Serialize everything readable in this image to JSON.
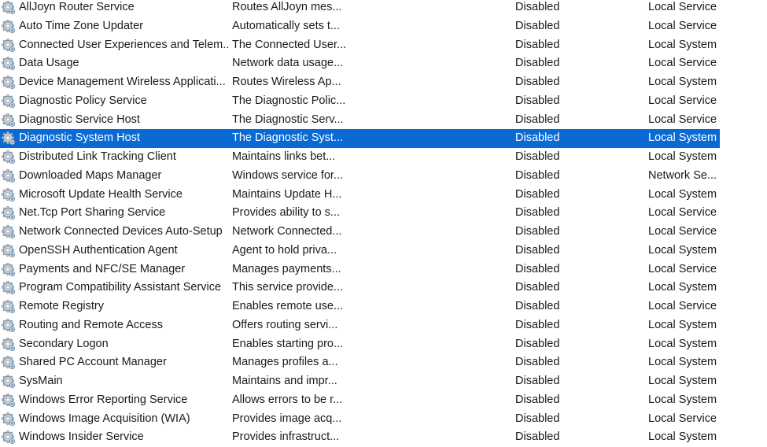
{
  "services": [
    {
      "name": "AllJoyn Router Service",
      "description": "Routes AllJoyn mes...",
      "status": "",
      "startup_type": "Disabled",
      "log_on_as": "Local Service",
      "icon": "gear-icon"
    },
    {
      "name": "Auto Time Zone Updater",
      "description": "Automatically sets t...",
      "status": "",
      "startup_type": "Disabled",
      "log_on_as": "Local Service",
      "icon": "gear-icon"
    },
    {
      "name": "Connected User Experiences and Telem...",
      "description": "The Connected User...",
      "status": "",
      "startup_type": "Disabled",
      "log_on_as": "Local System",
      "icon": "gear-icon"
    },
    {
      "name": "Data Usage",
      "description": "Network data usage...",
      "status": "",
      "startup_type": "Disabled",
      "log_on_as": "Local Service",
      "icon": "gear-icon"
    },
    {
      "name": "Device Management Wireless Applicati...",
      "description": "Routes Wireless Ap...",
      "status": "",
      "startup_type": "Disabled",
      "log_on_as": "Local System",
      "icon": "gear-icon"
    },
    {
      "name": "Diagnostic Policy Service",
      "description": "The Diagnostic Polic...",
      "status": "",
      "startup_type": "Disabled",
      "log_on_as": "Local Service",
      "icon": "gear-icon"
    },
    {
      "name": "Diagnostic Service Host",
      "description": "The Diagnostic Serv...",
      "status": "",
      "startup_type": "Disabled",
      "log_on_as": "Local Service",
      "icon": "gear-icon"
    },
    {
      "name": "Diagnostic System Host",
      "description": "The Diagnostic Syst...",
      "status": "",
      "startup_type": "Disabled",
      "log_on_as": "Local System",
      "icon": "gear-icon",
      "selected": true
    },
    {
      "name": "Distributed Link Tracking Client",
      "description": "Maintains links bet...",
      "status": "",
      "startup_type": "Disabled",
      "log_on_as": "Local System",
      "icon": "gear-icon"
    },
    {
      "name": "Downloaded Maps Manager",
      "description": "Windows service for...",
      "status": "",
      "startup_type": "Disabled",
      "log_on_as": "Network Se...",
      "icon": "gear-icon"
    },
    {
      "name": "Microsoft Update Health Service",
      "description": "Maintains Update H...",
      "status": "",
      "startup_type": "Disabled",
      "log_on_as": "Local System",
      "icon": "gear-icon"
    },
    {
      "name": "Net.Tcp Port Sharing Service",
      "description": "Provides ability to s...",
      "status": "",
      "startup_type": "Disabled",
      "log_on_as": "Local Service",
      "icon": "gear-icon"
    },
    {
      "name": "Network Connected Devices Auto-Setup",
      "description": "Network Connected...",
      "status": "",
      "startup_type": "Disabled",
      "log_on_as": "Local Service",
      "icon": "gear-icon"
    },
    {
      "name": "OpenSSH Authentication Agent",
      "description": "Agent to hold priva...",
      "status": "",
      "startup_type": "Disabled",
      "log_on_as": "Local System",
      "icon": "gear-icon"
    },
    {
      "name": "Payments and NFC/SE Manager",
      "description": "Manages payments...",
      "status": "",
      "startup_type": "Disabled",
      "log_on_as": "Local Service",
      "icon": "gear-icon"
    },
    {
      "name": "Program Compatibility Assistant Service",
      "description": "This service provide...",
      "status": "",
      "startup_type": "Disabled",
      "log_on_as": "Local System",
      "icon": "gear-icon"
    },
    {
      "name": "Remote Registry",
      "description": "Enables remote use...",
      "status": "",
      "startup_type": "Disabled",
      "log_on_as": "Local Service",
      "icon": "gear-icon"
    },
    {
      "name": "Routing and Remote Access",
      "description": "Offers routing servi...",
      "status": "",
      "startup_type": "Disabled",
      "log_on_as": "Local System",
      "icon": "gear-icon"
    },
    {
      "name": "Secondary Logon",
      "description": "Enables starting pro...",
      "status": "",
      "startup_type": "Disabled",
      "log_on_as": "Local System",
      "icon": "gear-icon"
    },
    {
      "name": "Shared PC Account Manager",
      "description": "Manages profiles a...",
      "status": "",
      "startup_type": "Disabled",
      "log_on_as": "Local System",
      "icon": "gear-icon"
    },
    {
      "name": "SysMain",
      "description": "Maintains and impr...",
      "status": "",
      "startup_type": "Disabled",
      "log_on_as": "Local System",
      "icon": "gear-icon"
    },
    {
      "name": "Windows Error Reporting Service",
      "description": "Allows errors to be r...",
      "status": "",
      "startup_type": "Disabled",
      "log_on_as": "Local System",
      "icon": "gear-icon"
    },
    {
      "name": "Windows Image Acquisition (WIA)",
      "description": "Provides image acq...",
      "status": "",
      "startup_type": "Disabled",
      "log_on_as": "Local Service",
      "icon": "gear-icon"
    },
    {
      "name": "Windows Insider Service",
      "description": "Provides infrastruct...",
      "status": "",
      "startup_type": "Disabled",
      "log_on_as": "Local System",
      "icon": "gear-icon"
    }
  ],
  "colors": {
    "selection_background": "#0a6ad4",
    "selection_text": "#ffffff",
    "text": "#1a1a1a",
    "gear_fill": "#c7d2dc",
    "gear_stroke": "#6d7f8f",
    "gear_accent": "#3a88c8"
  }
}
